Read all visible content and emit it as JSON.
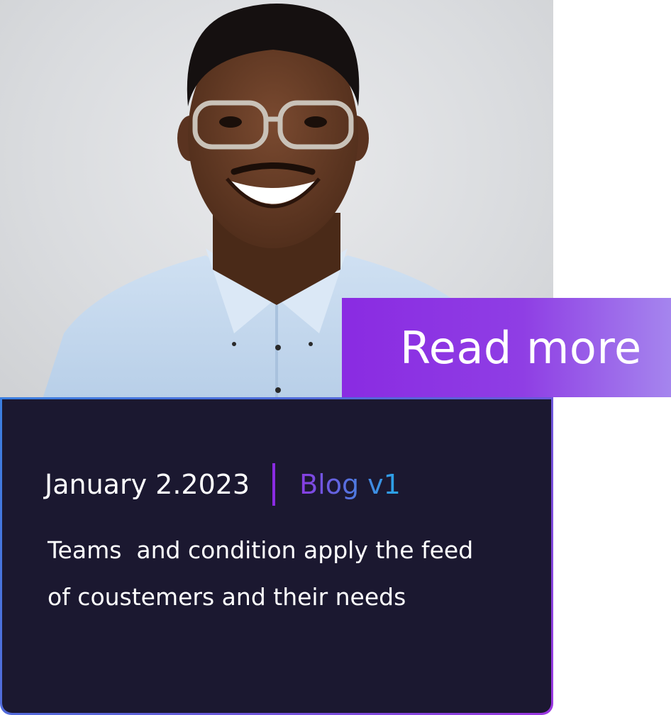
{
  "card": {
    "image": {
      "subject": "portrait-photo"
    },
    "read_more_label": "Read more",
    "date": "January 2.2023",
    "category": "Blog v1",
    "description_line1": "Teams  and condition apply the feed",
    "description_line2": "of coustemers and their needs"
  },
  "colors": {
    "card_background": "#1b1830",
    "accent_purple": "#8a2be2",
    "accent_blue": "#27a7e8",
    "text": "#ffffff"
  }
}
